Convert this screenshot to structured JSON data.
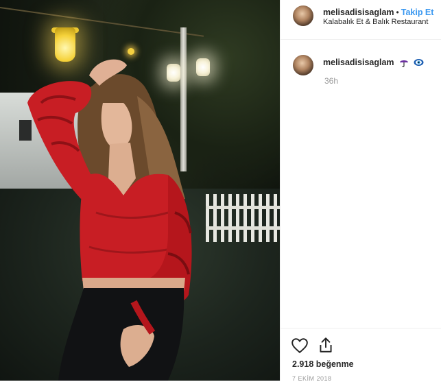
{
  "post": {
    "username": "melisadisisaglam",
    "follow_label": "Takip Et",
    "separator": "•",
    "location": "Kalabalık Et & Balık Restaurant"
  },
  "comment": {
    "username": "melisadisisaglam",
    "emojis": [
      "umbrella-icon",
      "evil-eye-icon"
    ],
    "time": "36h"
  },
  "actions": {
    "likes": "2.918 beğenme",
    "date": "7 EKİM 2018"
  },
  "colors": {
    "accent": "#3897f0",
    "text": "#262626",
    "muted": "#999999",
    "blouse": "#c81e24"
  }
}
